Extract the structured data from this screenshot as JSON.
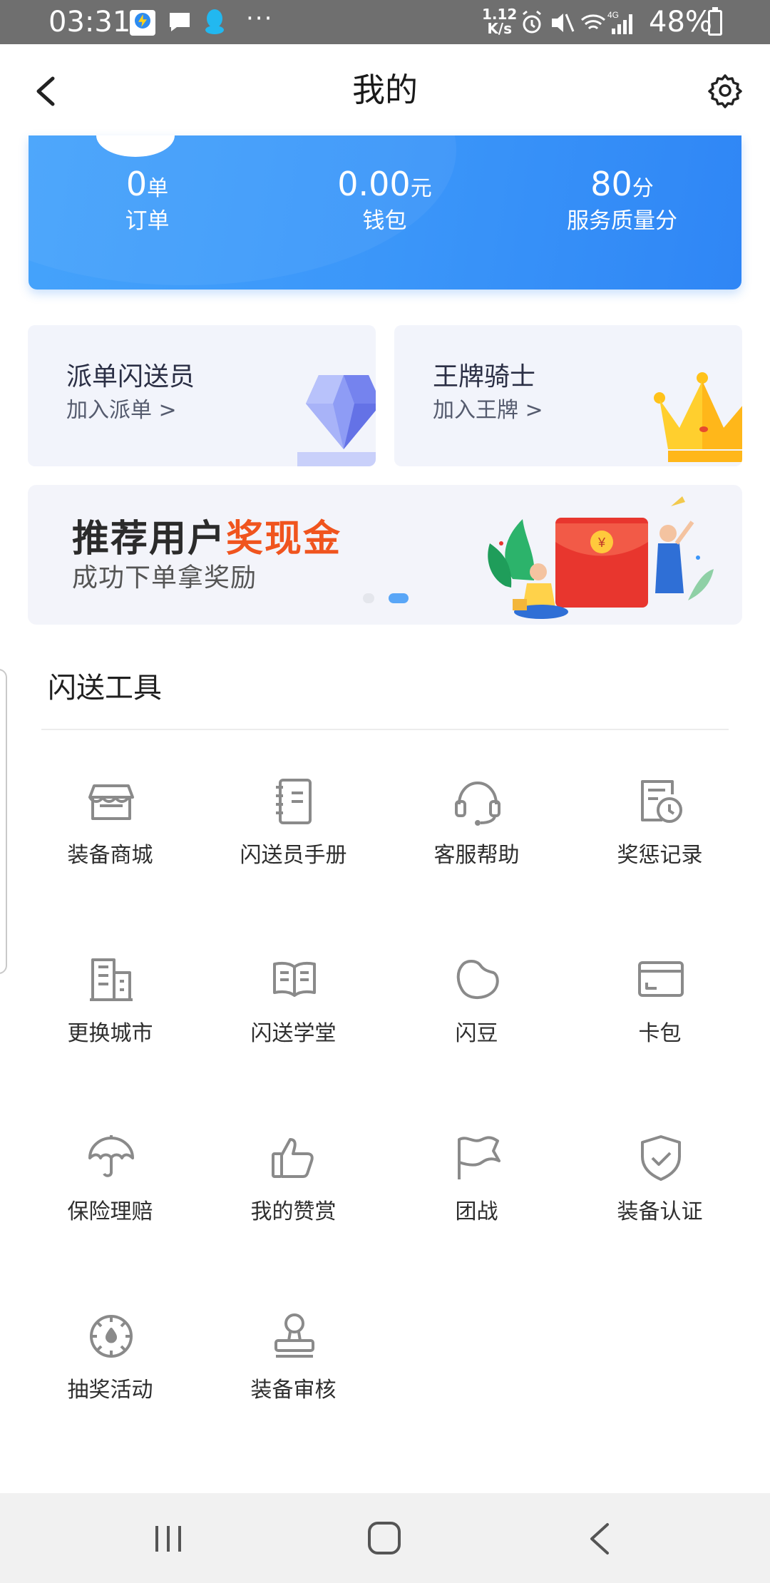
{
  "status_bar": {
    "time": "03:31",
    "more": "···",
    "net_speed_value": "1.12",
    "net_speed_unit": "K/s",
    "network_type": "4G",
    "battery": "48%"
  },
  "header": {
    "title": "我的",
    "back_icon": "chevron-left-icon",
    "settings_icon": "gear-icon"
  },
  "stats": [
    {
      "value": "0",
      "unit": "单",
      "label": "订单"
    },
    {
      "value": "0.00",
      "unit": "元",
      "label": "钱包"
    },
    {
      "value": "80",
      "unit": "分",
      "label": "服务质量分"
    }
  ],
  "promos": [
    {
      "title": "派单闪送员",
      "link": "加入派单 >",
      "icon": "diamond-icon"
    },
    {
      "title": "王牌骑士",
      "link": "加入王牌 >",
      "icon": "crown-icon"
    }
  ],
  "banner": {
    "title_main": "推荐用户",
    "title_highlight": "奖现金",
    "subtitle": "成功下单拿奖励",
    "slides_total": 2,
    "active_slide": 2,
    "colors": {
      "highlight": "#f0541e",
      "dot_active": "#59a6f7"
    }
  },
  "tools": {
    "title": "闪送工具",
    "items": [
      {
        "label": "装备商城",
        "icon": "store-icon"
      },
      {
        "label": "闪送员手册",
        "icon": "notebook-icon"
      },
      {
        "label": "客服帮助",
        "icon": "headset-icon"
      },
      {
        "label": "奖惩记录",
        "icon": "record-clock-icon"
      },
      {
        "label": "更换城市",
        "icon": "buildings-icon"
      },
      {
        "label": "闪送学堂",
        "icon": "open-book-icon"
      },
      {
        "label": "闪豆",
        "icon": "bean-icon"
      },
      {
        "label": "卡包",
        "icon": "card-icon"
      },
      {
        "label": "保险理赔",
        "icon": "umbrella-icon"
      },
      {
        "label": "我的赞赏",
        "icon": "thumbs-up-icon"
      },
      {
        "label": "团战",
        "icon": "flag-icon"
      },
      {
        "label": "装备认证",
        "icon": "shield-check-icon"
      },
      {
        "label": "抽奖活动",
        "icon": "lottery-wheel-icon"
      },
      {
        "label": "装备审核",
        "icon": "stamp-icon"
      }
    ]
  },
  "theme": {
    "primary_blue": "#3a95f9",
    "icon_gray": "#8a8a8a"
  }
}
